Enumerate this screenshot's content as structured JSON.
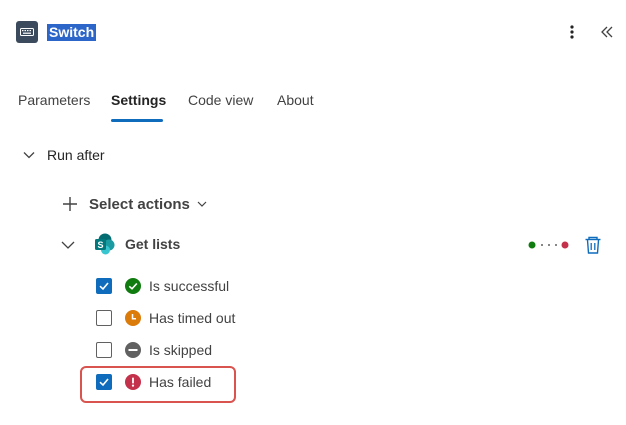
{
  "header": {
    "title": "Switch",
    "app_icon": "keyboard-icon",
    "more_icon": "more-vertical-icon",
    "collapse_icon": "double-chevron-left-icon"
  },
  "tabs": [
    {
      "label": "Parameters",
      "active": false
    },
    {
      "label": "Settings",
      "active": true
    },
    {
      "label": "Code view",
      "active": false
    },
    {
      "label": "About",
      "active": false
    }
  ],
  "run_after": {
    "label": "Run after",
    "expanded": true,
    "select_actions_label": "Select actions",
    "action": {
      "label": "Get lists",
      "icon": "sharepoint-icon",
      "expanded": true,
      "conditions": [
        {
          "label": "Is successful",
          "checked": true,
          "icon": "success-icon",
          "color": "#107c10"
        },
        {
          "label": "Has timed out",
          "checked": false,
          "icon": "clock-icon",
          "color": "#da7b0a"
        },
        {
          "label": "Is skipped",
          "checked": false,
          "icon": "skipped-icon",
          "color": "#616161"
        },
        {
          "label": "Has failed",
          "checked": true,
          "icon": "error-icon",
          "color": "#c4314b"
        }
      ]
    }
  },
  "colors": {
    "accent": "#0f6cbd",
    "title_highlight": "#2d66c9",
    "callout_border": "#d9534f"
  }
}
